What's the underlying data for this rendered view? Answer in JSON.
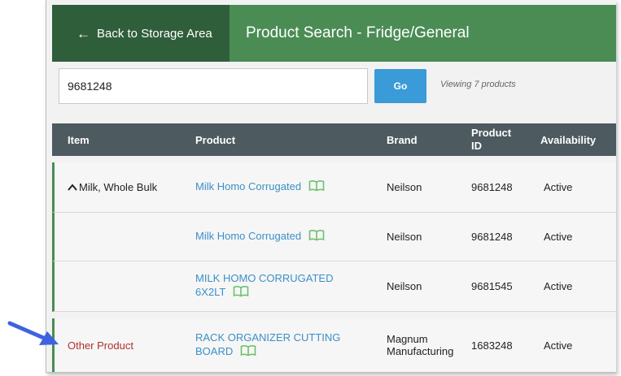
{
  "header": {
    "back_label": "Back to Storage Area",
    "title": "Product Search - Fridge/General"
  },
  "search": {
    "value": "9681248",
    "go_label": "Go",
    "viewing_text": "Viewing 7 products"
  },
  "table": {
    "columns": {
      "item": "Item",
      "product": "Product",
      "brand": "Brand",
      "product_id_line1": "Product",
      "product_id_line2": "ID",
      "availability": "Availability"
    },
    "rows": [
      {
        "item": "Milk, Whole Bulk",
        "product_line1": "Milk Homo Corrugated",
        "product_line2": "",
        "brand_line1": "Neilson",
        "brand_line2": "",
        "product_id": "9681248",
        "availability": "Active"
      },
      {
        "item": "",
        "product_line1": "Milk Homo Corrugated",
        "product_line2": "",
        "brand_line1": "Neilson",
        "brand_line2": "",
        "product_id": "9681248",
        "availability": "Active"
      },
      {
        "item": "",
        "product_line1": "MILK HOMO CORRUGATED",
        "product_line2": "6X2LT",
        "brand_line1": "Neilson",
        "brand_line2": "",
        "product_id": "9681545",
        "availability": "Active"
      },
      {
        "item": "Other Product",
        "product_line1": "RACK ORGANIZER CUTTING",
        "product_line2": "BOARD",
        "brand_line1": "Magnum",
        "brand_line2": "Manufacturing",
        "product_id": "1683248",
        "availability": "Active"
      }
    ]
  },
  "icons": {
    "back": "arrow-left-icon",
    "expand": "chevron-up-icon",
    "product_info": "book-icon",
    "annotation": "pointer-arrow-icon"
  },
  "colors": {
    "dark_green": "#2f5e3b",
    "green": "#4b8c55",
    "blue": "#3b9ad8",
    "link": "#3c8fc8",
    "red": "#b03030",
    "table_header": "#4d5a60",
    "annotation_arrow": "#3d63e0"
  }
}
